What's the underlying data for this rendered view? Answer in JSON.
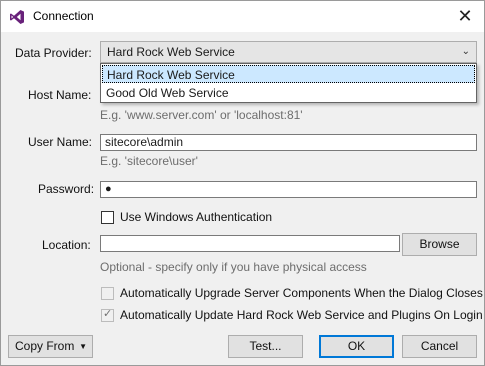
{
  "window": {
    "title": "Connection",
    "close_glyph": "✕"
  },
  "data_provider": {
    "label": "Data Provider:",
    "selected": "Hard Rock Web Service",
    "options": [
      "Hard Rock Web Service",
      "Good Old Web Service"
    ]
  },
  "host": {
    "label": "Host Name:",
    "hint": "E.g. 'www.server.com' or 'localhost:81'"
  },
  "user": {
    "label": "User Name:",
    "value": "sitecore\\admin",
    "hint": "E.g. 'sitecore\\user'"
  },
  "password": {
    "label": "Password:",
    "value": "●"
  },
  "windows_auth": {
    "label": "Use Windows Authentication",
    "checked": false
  },
  "location": {
    "label": "Location:",
    "value": "",
    "browse": "Browse",
    "hint": "Optional - specify only if you have physical access"
  },
  "auto_upgrade": {
    "label": "Automatically Upgrade Server Components When the Dialog Closes",
    "checked": false,
    "disabled": true
  },
  "auto_update": {
    "label": "Automatically Update Hard Rock Web Service and Plugins On Login",
    "checked": true,
    "disabled": true
  },
  "footer": {
    "copy_from": "Copy From",
    "test": "Test...",
    "ok": "OK",
    "cancel": "Cancel"
  },
  "colors": {
    "accent": "#0078d7",
    "selection": "#cce8ff",
    "hint": "#6d6d6d",
    "vs_purple": "#68217a"
  }
}
